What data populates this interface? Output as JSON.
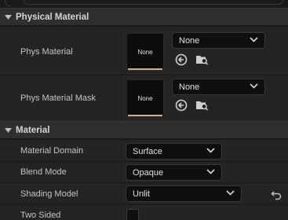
{
  "sections": {
    "physical_material": {
      "title": "Physical Material",
      "rows": {
        "phys_material": {
          "label": "Phys Material",
          "thumb": "None",
          "value": "None"
        },
        "phys_material_mask": {
          "label": "Phys Material Mask",
          "thumb": "None",
          "value": "None"
        }
      }
    },
    "material": {
      "title": "Material",
      "rows": {
        "material_domain": {
          "label": "Material Domain",
          "value": "Surface"
        },
        "blend_mode": {
          "label": "Blend Mode",
          "value": "Opaque"
        },
        "shading_model": {
          "label": "Shading Model",
          "value": "Unlit"
        },
        "two_sided": {
          "label": "Two Sided",
          "checked": false
        }
      }
    }
  },
  "colors": {
    "accent_underline": "#c8b087",
    "background": "#1a1a1a",
    "header": "#2f2f2f",
    "row": "#242424"
  },
  "icons": [
    "chevron-down-icon",
    "use-selected-arrow-icon",
    "browse-asset-icon",
    "reset-to-default-icon"
  ]
}
